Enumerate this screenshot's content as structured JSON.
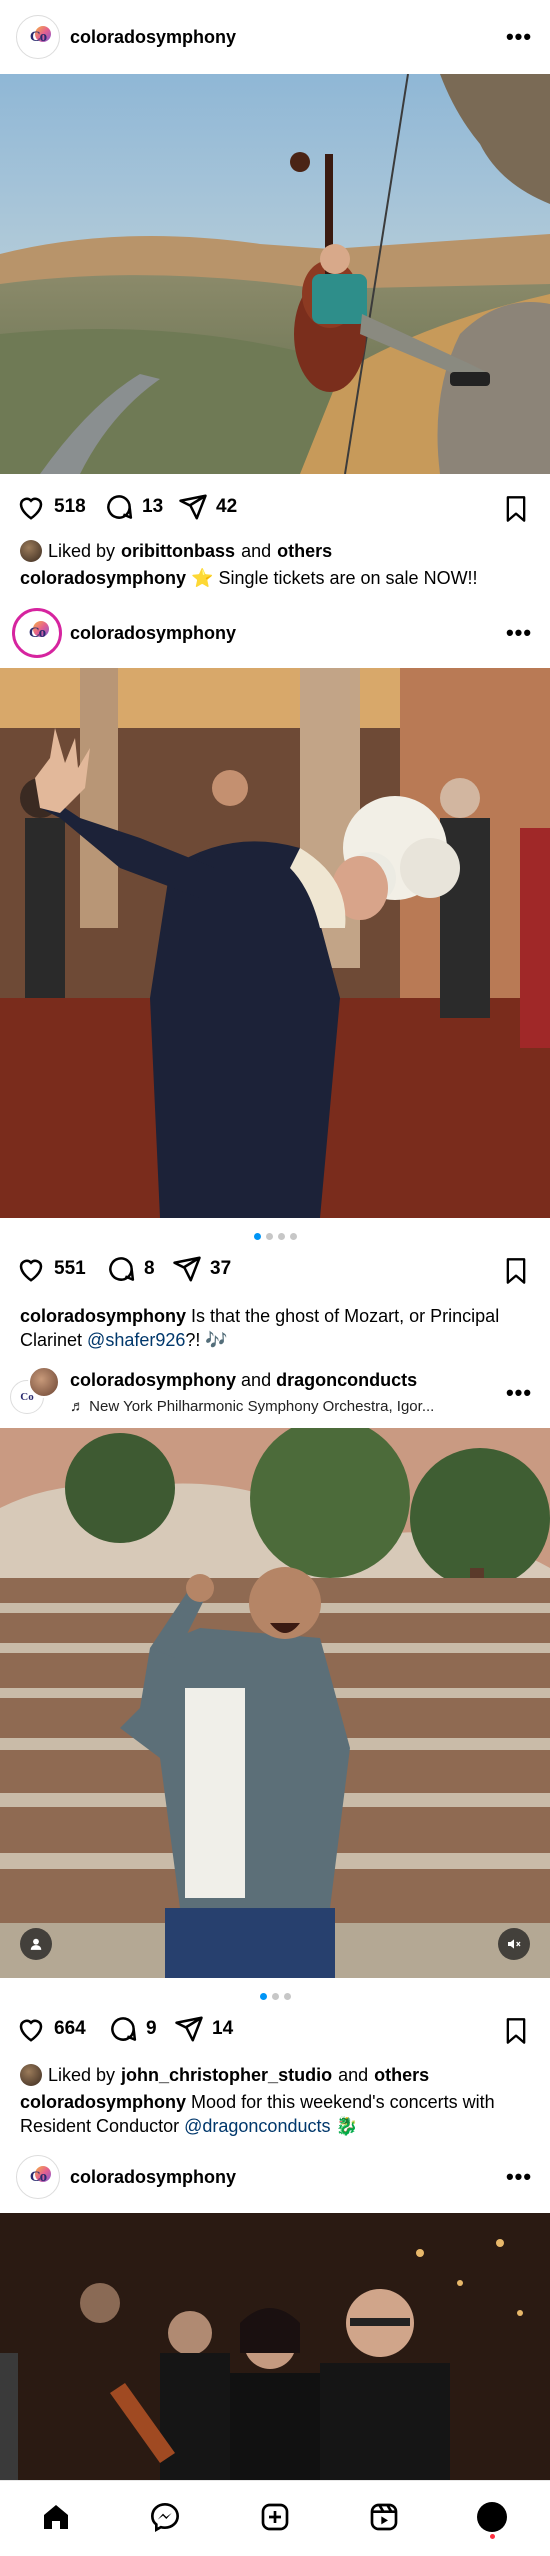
{
  "posts": [
    {
      "username": "coloradosymphony",
      "avatar_text": "Co",
      "likes": "518",
      "comments": "13",
      "shares": "42",
      "liked_by_prefix": "Liked by",
      "liked_by_user": "oribittonbass",
      "liked_by_and": "and",
      "liked_by_others": "others",
      "caption_user": "coloradosymphony",
      "caption_text": "⭐ Single tickets are on sale NOW!!"
    },
    {
      "username": "coloradosymphony",
      "avatar_text": "Co",
      "likes": "551",
      "comments": "8",
      "shares": "37",
      "caption_user": "coloradosymphony",
      "caption_text": "Is that the ghost of Mozart, or Principal Clarinet",
      "caption_mention": "@shafer926",
      "caption_tail": "?! 🎶"
    },
    {
      "username_a": "coloradosymphony",
      "username_and": "and",
      "username_b": "dragonconducts",
      "audio": "♬ New York Philharmonic Symphony Orchestra, Igor...",
      "avatar_text": "Co",
      "likes": "664",
      "comments": "9",
      "shares": "14",
      "liked_by_prefix": "Liked by",
      "liked_by_user": "john_christopher_studio",
      "liked_by_and": "and",
      "liked_by_others": "others",
      "caption_user": "coloradosymphony",
      "caption_text": "Mood for this weekend's concerts with Resident Conductor",
      "caption_mention": "@dragonconducts",
      "caption_tail": "🐉"
    },
    {
      "username": "coloradosymphony",
      "avatar_text": "Co"
    }
  ],
  "more_glyph": "•••",
  "nav": [
    "home",
    "messenger",
    "create",
    "reels",
    "profile"
  ],
  "colors": {
    "mention": "#00376b",
    "active_dot": "#0095f6",
    "notification": "#ff3040"
  }
}
